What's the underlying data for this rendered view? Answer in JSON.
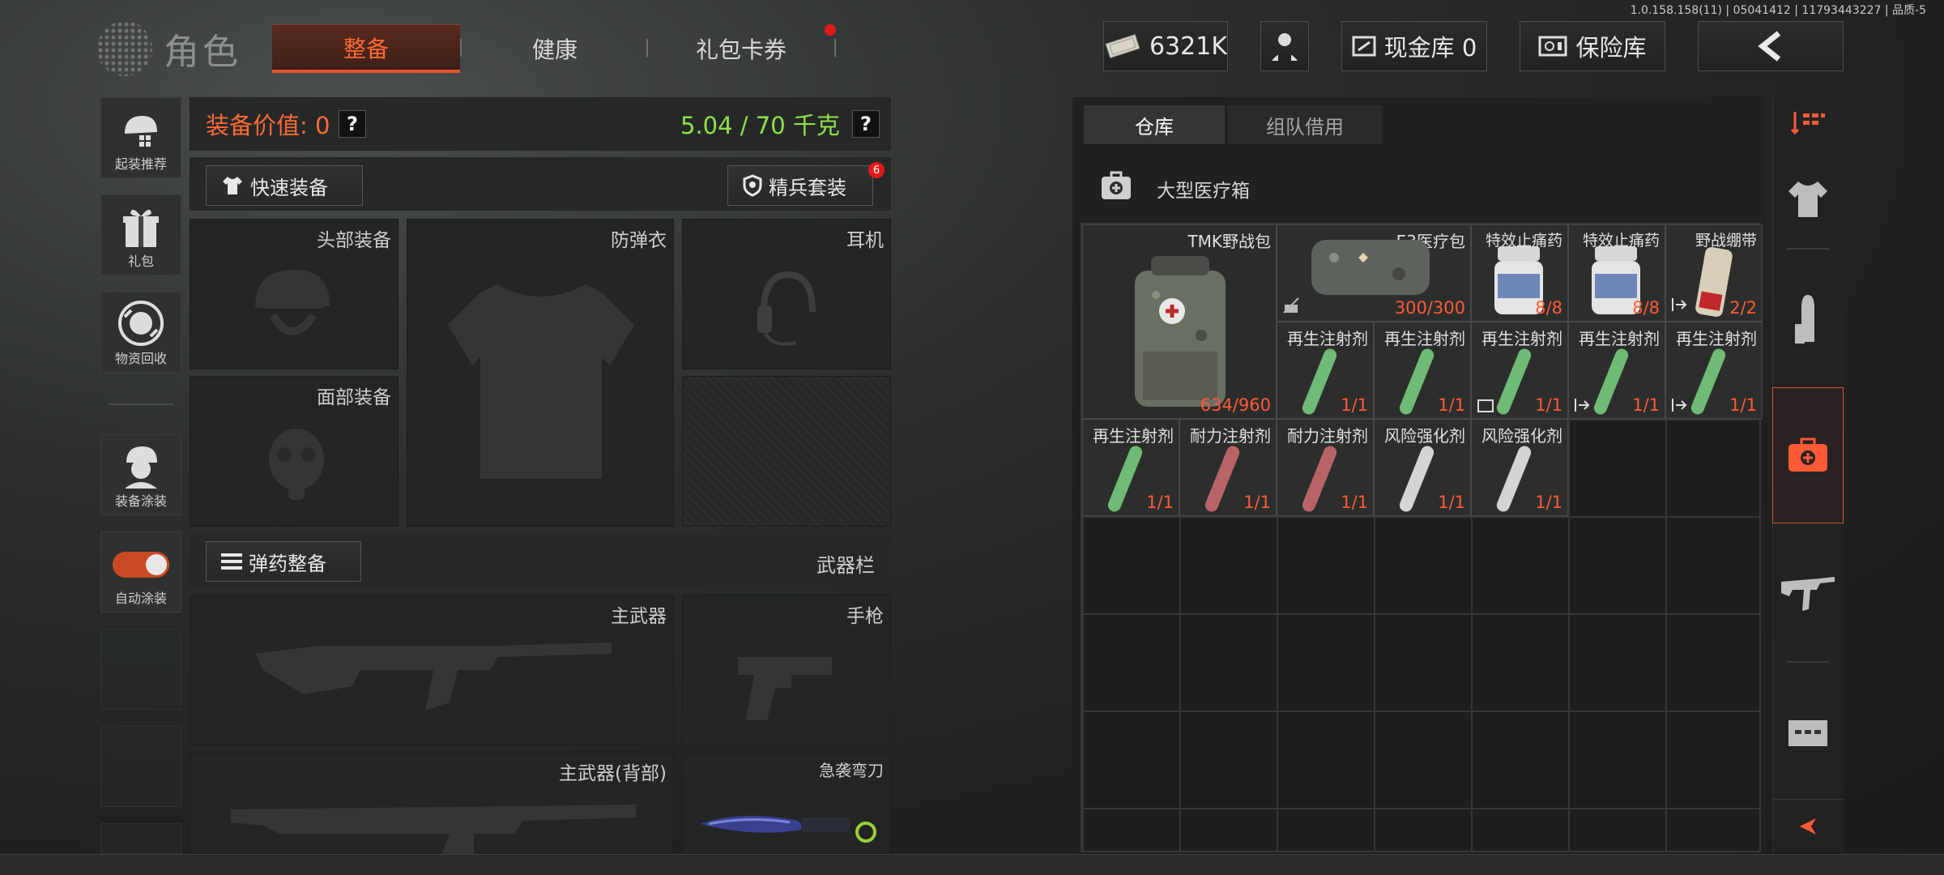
{
  "version": "1.0.158.158(11) | 05041412 | 11793443227 | 品质-5",
  "brand": {
    "title": "角色"
  },
  "tabs": [
    "整备",
    "健康",
    "礼包卡券"
  ],
  "topbar": {
    "money": "6321K",
    "cash_vault": "现金库 0",
    "safe_box": "保险库"
  },
  "left_rail": {
    "items": [
      "起装推荐",
      "礼包",
      "物资回收",
      "装备涂装",
      "自动涂装"
    ]
  },
  "equipment": {
    "value_label": "装备价值: 0",
    "weight": "5.04 / 70 千克",
    "quick_equip": "快速装备",
    "elite_kit": "精兵套装",
    "elite_badge": "6",
    "slots": {
      "head": "头部装备",
      "armor": "防弹衣",
      "headset": "耳机",
      "face": "面部装备"
    },
    "ammo_button": "弹药整备",
    "weapons_label": "武器栏",
    "weapon_slots": {
      "primary": "主武器",
      "pistol": "手枪",
      "primary_back": "主武器(背部)",
      "knife": "急袭弯刀"
    }
  },
  "inventory": {
    "tabs": [
      "仓库",
      "组队借用"
    ],
    "container": "大型医疗箱",
    "items": [
      {
        "name": "TMK野战包",
        "count": "634/960"
      },
      {
        "name": "E3医疗包",
        "count": "300/300"
      },
      {
        "name": "特效止痛药",
        "count": "8/8"
      },
      {
        "name": "特效止痛药",
        "count": "8/8"
      },
      {
        "name": "野战绷带",
        "count": "2/2"
      },
      {
        "name": "再生注射剂",
        "count": "1/1"
      },
      {
        "name": "再生注射剂",
        "count": "1/1"
      },
      {
        "name": "再生注射剂",
        "count": "1/1"
      },
      {
        "name": "再生注射剂",
        "count": "1/1"
      },
      {
        "name": "再生注射剂",
        "count": "1/1"
      },
      {
        "name": "再生注射剂",
        "count": "1/1"
      },
      {
        "name": "耐力注射剂",
        "count": "1/1"
      },
      {
        "name": "耐力注射剂",
        "count": "1/1"
      },
      {
        "name": "风险强化剂",
        "count": "1/1"
      },
      {
        "name": "风险强化剂",
        "count": "1/1"
      }
    ]
  },
  "colors": {
    "accent": "#ff6a33",
    "weight_green": "#8fe04a",
    "count_red": "#ff5a36"
  }
}
